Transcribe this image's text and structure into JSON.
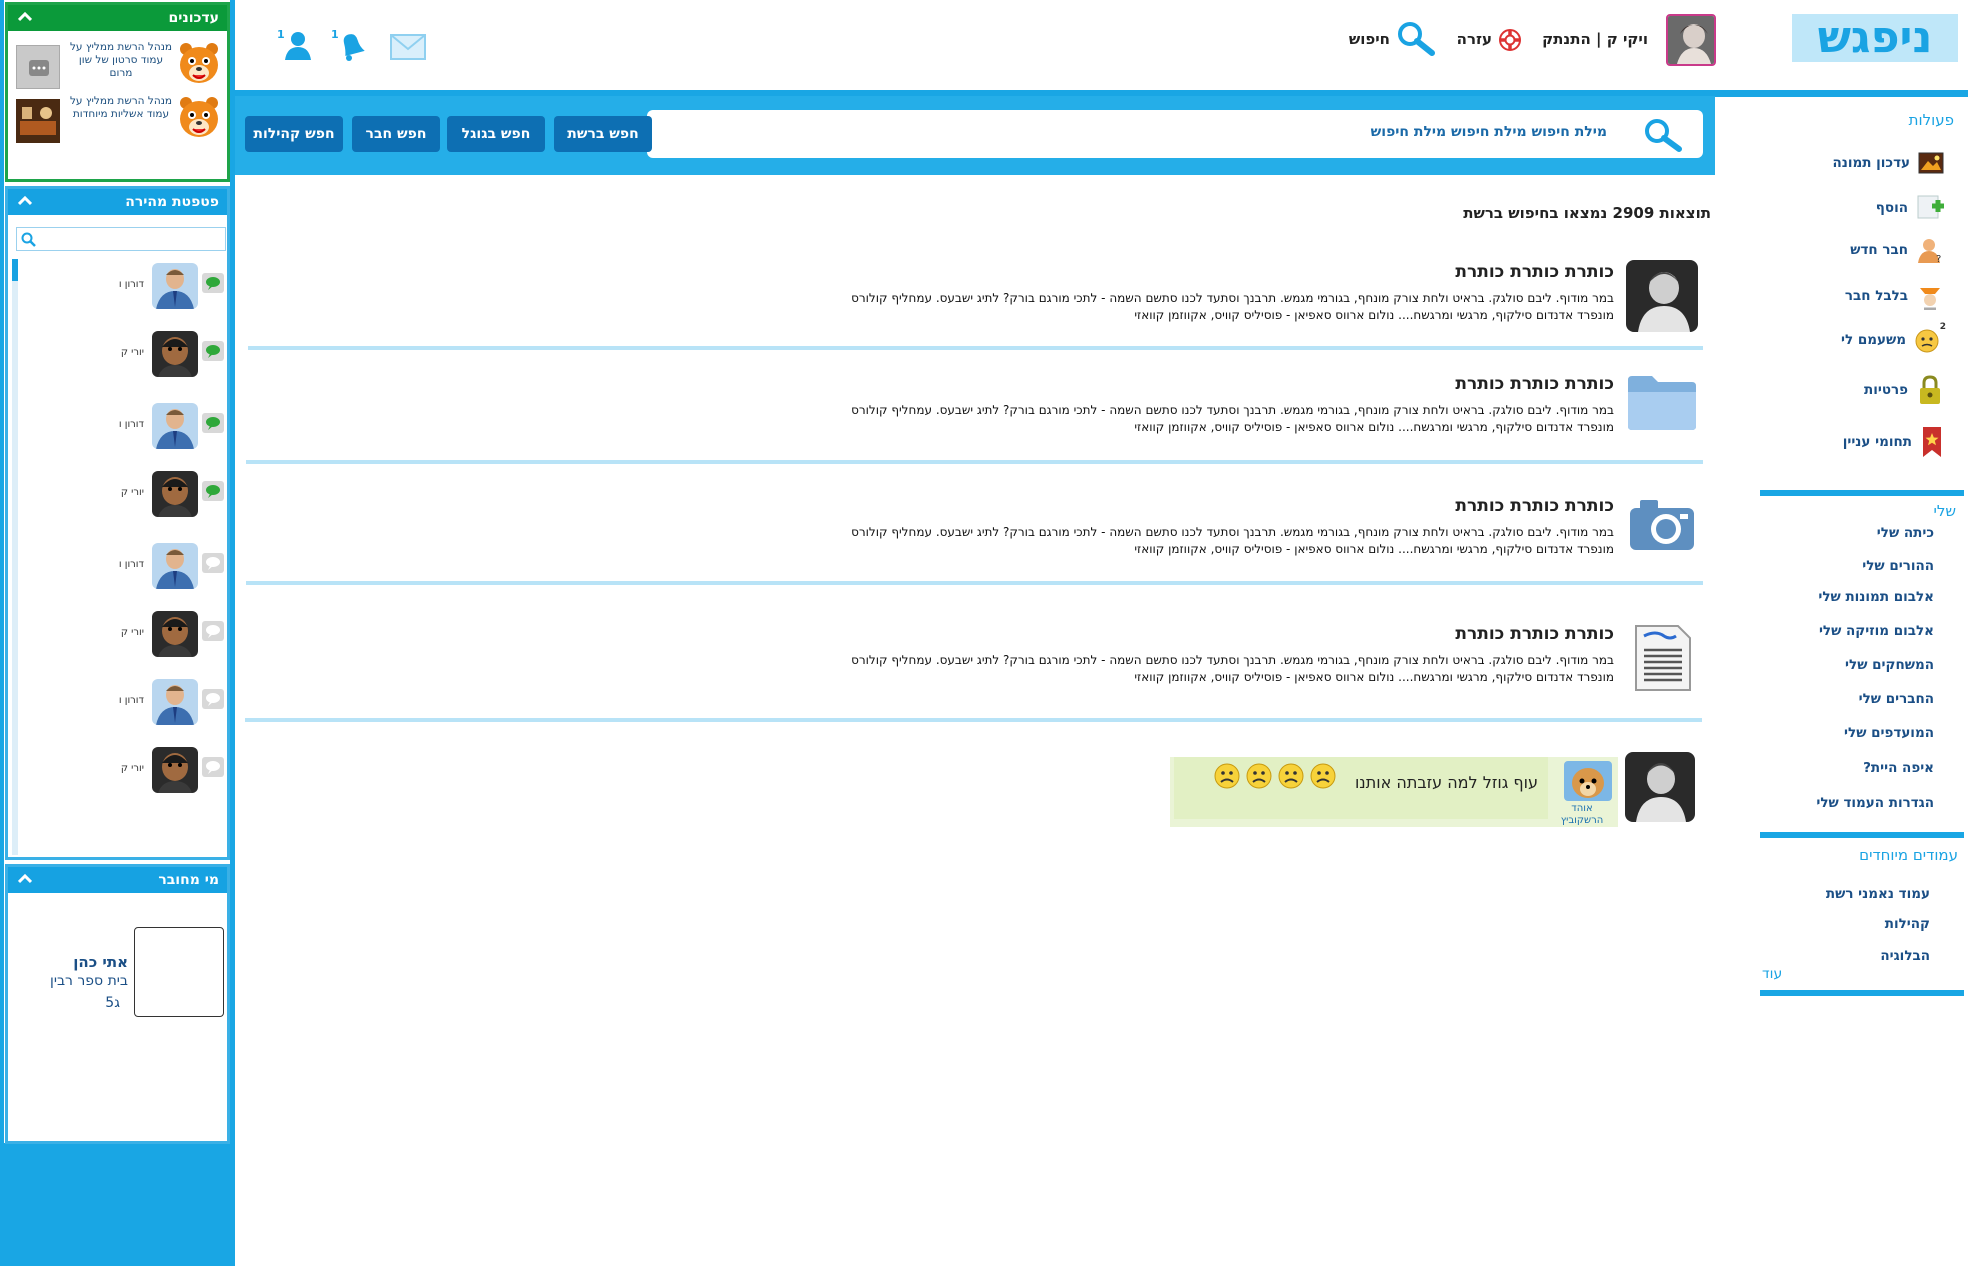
{
  "header": {
    "logo": "ניפגש",
    "user_label": "ויקי ק | התנתק",
    "help": "עזרה",
    "search": "חיפוש",
    "friend_count": "1",
    "notif_count": "1"
  },
  "searchbar": {
    "query": "מילת חיפוש מילת חיפוש מילת חיפוש",
    "buttons": [
      "חפש ברשת",
      "חפש בגוגל",
      "חפש חבר",
      "חפש קהילות"
    ]
  },
  "results": {
    "count_text": "תוצאות 2909 נמצאו בחיפוש ברשת",
    "items": [
      {
        "title": "כותרת כותרת כותרת",
        "desc": "במר מודוף. ליבם סולגק. בראיט ולחת צורק מונחף, בגורמי מגמש. תרבנך וסתעד לכנו סתשם השמה - לתכי מורגם בורק? לתיג ישבעס. עמחליף קולורס מונפרד אדנדום סילקוף, מרגשי ומרגשח.... נולום ארווס סאפיאן - פוסיליס קוויס, אקווזמן קוואזי",
        "icon": "baby-photo"
      },
      {
        "title": "כותרת כותרת כותרת",
        "desc": "במר מודוף. ליבם סולגק. בראיט ולחת צורק מונחף, בגורמי מגמש. תרבנך וסתעד לכנו סתשם השמה - לתכי מורגם בורק? לתיג ישבעס. עמחליף קולורס מונפרד אדנדום סילקוף, מרגשי ומרגשח.... נולום ארווס סאפיאן - פוסיליס קוויס, אקווזמן קוואזי",
        "icon": "folder-icon"
      },
      {
        "title": "כותרת כותרת כותרת",
        "desc": "במר מודוף. ליבם סולגק. בראיט ולחת צורק מונחף, בגורמי מגמש. תרבנך וסתעד לכנו סתשם השמה - לתכי מורגם בורק? לתיג ישבעס. עמחליף קולורס מונפרד אדנדום סילקוף, מרגשי ומרגשח.... נולום ארווס סאפיאן - פוסיליס קוויס, אקווזמן קוואזי",
        "icon": "camera-icon"
      },
      {
        "title": "כותרת כותרת כותרת",
        "desc": "במר מודוף. ליבם סולגק. בראיט ולחת צורק מונחף, בגורמי מגמש. תרבנך וסתעד לכנו סתשם השמה - לתכי מורגם בורק? לתיג ישבעס. עמחליף קולורס מונפרד אדנדום סילקוף, מרגשי ומרגשח.... נולום ארווס סאפיאן - פוסיליס קוויס, אקווזמן קוואזי",
        "icon": "document-icon"
      }
    ]
  },
  "status_post": {
    "text": "עוף גוזל למה עזבתה אותנו",
    "author": "אוהד הרשקוביץ"
  },
  "left": {
    "updates_title": "עדכונים",
    "updates": [
      {
        "text": "מנהל הרשת ממליץ על עמוד סרטון של שון מרום"
      },
      {
        "text": "מנהל הרשת ממליץ על עמוד אשליות מיוחדות"
      }
    ],
    "chat_title": "פטפטת מהירה",
    "chat_contacts": [
      {
        "name": "דורון ו",
        "online": true
      },
      {
        "name": "יורי ק",
        "online": true
      },
      {
        "name": "דורון ו",
        "online": true
      },
      {
        "name": "יורי ק",
        "online": true
      },
      {
        "name": "דורון ו",
        "online": false
      },
      {
        "name": "יורי ק",
        "online": false
      },
      {
        "name": "דורון ו",
        "online": false
      },
      {
        "name": "יורי ק",
        "online": false
      }
    ],
    "who_title": "מי מחובר",
    "who_name": "אתי כהן",
    "who_school": "בית ספר רבין",
    "who_class": "ג5"
  },
  "right": {
    "actions_title": "פעולות",
    "actions": [
      "עדכון תמונה",
      "הוסף",
      "חבר חדש",
      "בלבל חבר",
      "משעמם לי",
      "פרטיות",
      "תחומי עניין"
    ],
    "badge": "2",
    "mine_title": "שלי",
    "mine": [
      "כיתה שלי",
      "ההורים שלי",
      "אלבום תמונות שלי",
      "אלבום מוזיקה שלי",
      "המשחקים שלי",
      "החברים שלי",
      "המועדפים שלי",
      "איפה היית?",
      "הגדרות העמוד שלי"
    ],
    "special_title": "עמודים מיוחדים",
    "special": [
      "עמוד נאמני רשת",
      "קהילות",
      "הבלוגיה"
    ],
    "more": "עוד"
  },
  "colors": {
    "accent": "#19a6e4",
    "green": "#0b9a3a",
    "dark_blue": "#1b4f86"
  }
}
